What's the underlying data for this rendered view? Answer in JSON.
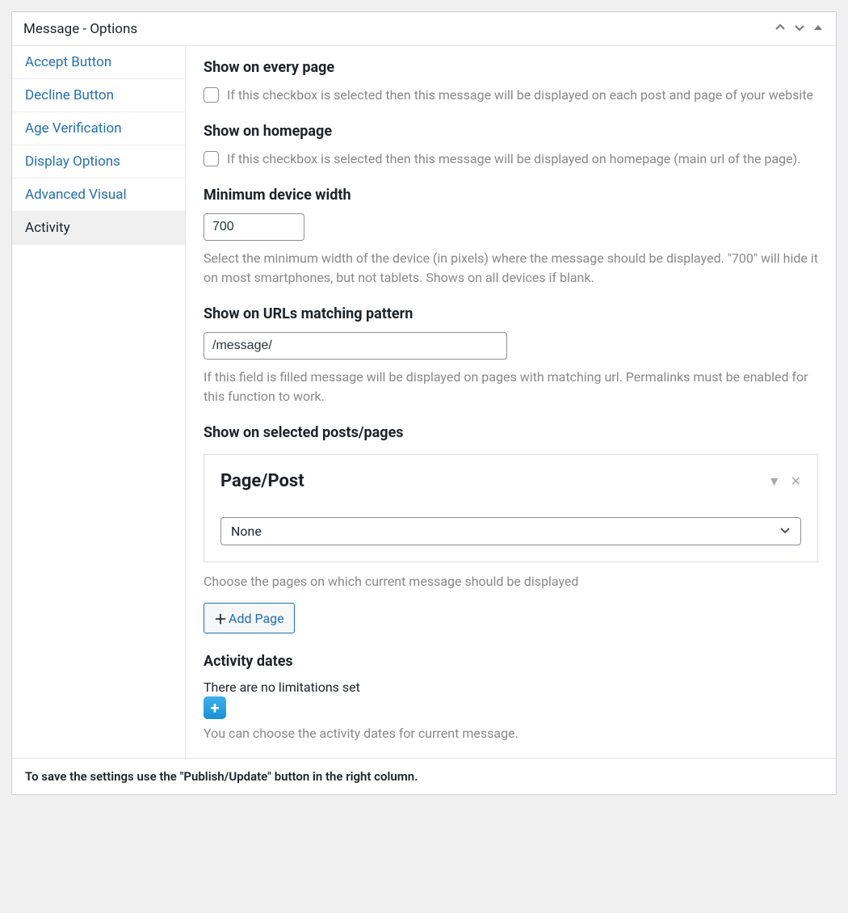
{
  "panel": {
    "title": "Message - Options"
  },
  "sidebar": {
    "items": [
      {
        "label": "Accept Button",
        "active": false
      },
      {
        "label": "Decline Button",
        "active": false
      },
      {
        "label": "Age Verification",
        "active": false
      },
      {
        "label": "Display Options",
        "active": false
      },
      {
        "label": "Advanced Visual",
        "active": false
      },
      {
        "label": "Activity",
        "active": true
      }
    ]
  },
  "sections": {
    "every_page": {
      "heading": "Show on every page",
      "desc": "If this checkbox is selected then this message will be displayed on each post and page of your website"
    },
    "homepage": {
      "heading": "Show on homepage",
      "desc": "If this checkbox is selected then this message will be displayed on homepage (main url of the page)."
    },
    "min_width": {
      "heading": "Minimum device width",
      "value": "700",
      "help": "Select the minimum width of the device (in pixels) where the message should be displayed. \"700\" will hide it on most smartphones, but not tablets. Shows on all devices if blank."
    },
    "url_pattern": {
      "heading": "Show on URLs matching pattern",
      "value": "/message/",
      "help": "If this field is filled message will be displayed on pages with matching url. Permalinks must be enabled for this function to work."
    },
    "selected": {
      "heading": "Show on selected posts/pages",
      "box_title": "Page/Post",
      "select_value": "None",
      "help": "Choose the pages on which current message should be displayed",
      "add_label": "Add Page"
    },
    "activity_dates": {
      "heading": "Activity dates",
      "status": "There are no limitations set",
      "help": "You can choose the activity dates for current message."
    }
  },
  "footer": {
    "text": "To save the settings use the \"Publish/Update\" button in the right column."
  }
}
